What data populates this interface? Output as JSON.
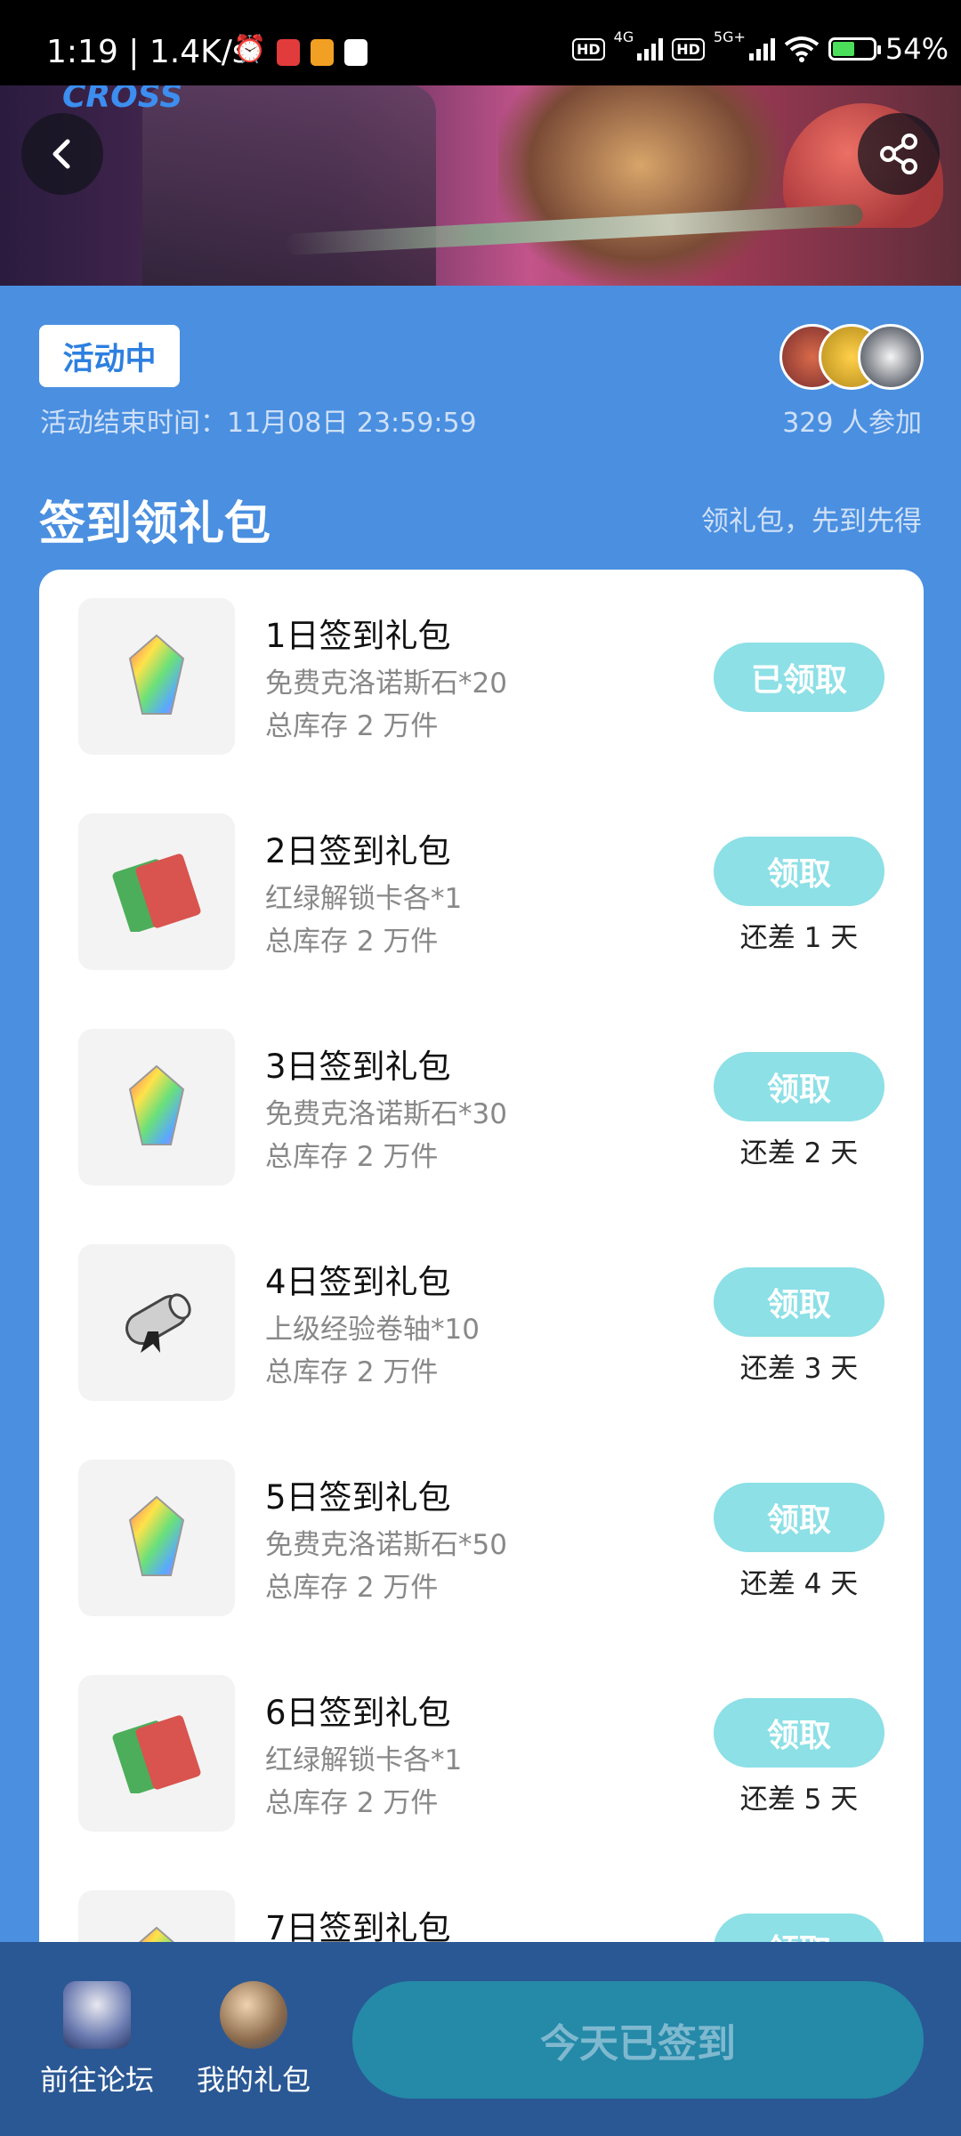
{
  "status_bar": {
    "time": "1:19",
    "speed": "1.4K/s",
    "net1": "4G",
    "net2": "5G+",
    "hd": "HD",
    "battery": "54%",
    "battery_level": 54
  },
  "banner": {
    "logo_text": "CROSS",
    "back_icon": "chevron-left-icon",
    "share_icon": "share-icon"
  },
  "activity": {
    "status": "活动中",
    "end_time": "活动结束时间：11月08日 23:59:59",
    "participants": "329 人参加"
  },
  "section": {
    "title": "签到领礼包",
    "subtitle": "领礼包，先到先得"
  },
  "gifts": [
    {
      "title": "1日签到礼包",
      "desc": "免费克洛诺斯石*20",
      "stock": "总库存 2 万件",
      "button": "已领取",
      "days_left": "",
      "icon": "rainbow-crystal-icon"
    },
    {
      "title": "2日签到礼包",
      "desc": "红绿解锁卡各*1",
      "stock": "总库存 2 万件",
      "button": "领取",
      "days_left": "还差 1 天",
      "icon": "unlock-cards-icon"
    },
    {
      "title": "3日签到礼包",
      "desc": "免费克洛诺斯石*30",
      "stock": "总库存 2 万件",
      "button": "领取",
      "days_left": "还差 2 天",
      "icon": "rainbow-crystal-icon"
    },
    {
      "title": "4日签到礼包",
      "desc": "上级经验卷轴*10",
      "stock": "总库存 2 万件",
      "button": "领取",
      "days_left": "还差 3 天",
      "icon": "scroll-icon"
    },
    {
      "title": "5日签到礼包",
      "desc": "免费克洛诺斯石*50",
      "stock": "总库存 2 万件",
      "button": "领取",
      "days_left": "还差 4 天",
      "icon": "rainbow-crystal-icon"
    },
    {
      "title": "6日签到礼包",
      "desc": "红绿解锁卡各*1",
      "stock": "总库存 2 万件",
      "button": "领取",
      "days_left": "还差 5 天",
      "icon": "unlock-cards-icon"
    },
    {
      "title": "7日签到礼包",
      "desc": "",
      "stock": "",
      "button": "领取",
      "days_left": "",
      "icon": "rainbow-crystal-icon"
    }
  ],
  "bottom_bar": {
    "forum_label": "前往论坛",
    "my_gifts_label": "我的礼包",
    "signed_label": "今天已签到"
  },
  "colors": {
    "background": "#4a8fe0",
    "accent": "#2d7fe0",
    "claim_button": "#8ce0e6",
    "bottom_bar": "#2a5894",
    "signed_button": "#2589a8"
  }
}
